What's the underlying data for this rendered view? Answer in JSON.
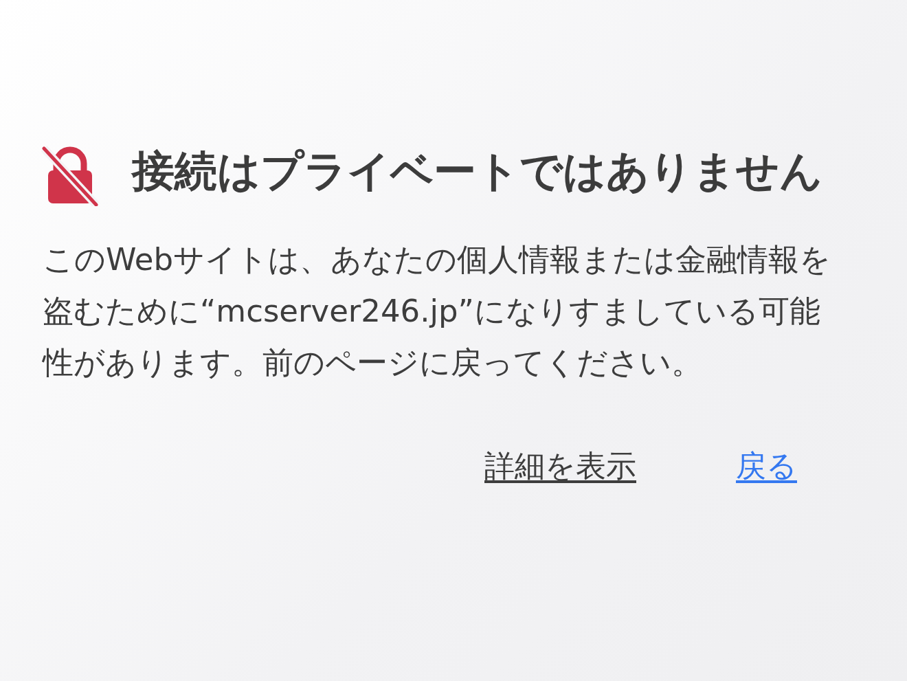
{
  "title": "接続はプライベートではありません",
  "message": "このWebサイトは、あなたの個人情報または金融情報を盗むために“mcserver246.jp”になりすましている可能性があります。前のページに戻ってください。",
  "links": [
    {
      "label": "詳細を表示",
      "kind": "secondary"
    },
    {
      "label": "戻る",
      "kind": "primary"
    }
  ]
}
